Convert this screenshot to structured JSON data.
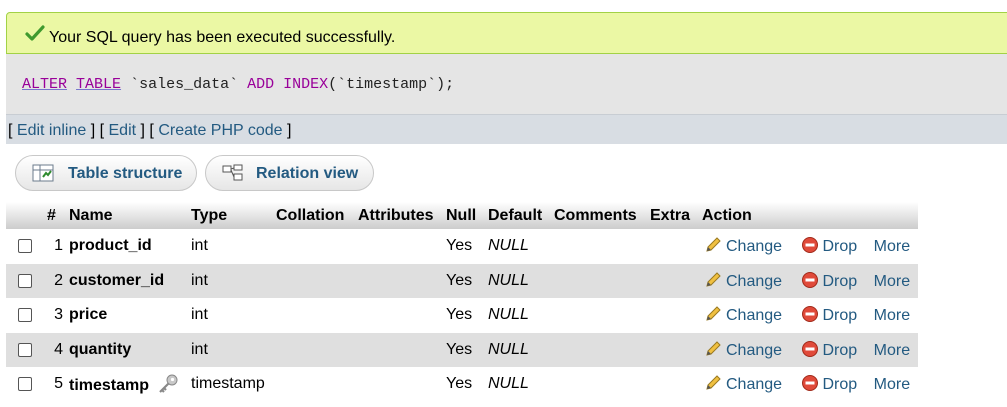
{
  "message": {
    "text": "Your SQL query has been executed successfully."
  },
  "sql": {
    "kw_alter": "ALTER",
    "kw_table": "TABLE",
    "table_name": "`sales_data`",
    "kw_add": "ADD",
    "kw_index": "INDEX",
    "arg": "(`timestamp`);"
  },
  "links": {
    "edit_inline": "Edit inline",
    "edit": "Edit",
    "create_php": "Create PHP code"
  },
  "tabs": {
    "structure": "Table structure",
    "relation": "Relation view"
  },
  "table": {
    "headers": {
      "num": "#",
      "name": "Name",
      "type": "Type",
      "collation": "Collation",
      "attributes": "Attributes",
      "null": "Null",
      "default": "Default",
      "comments": "Comments",
      "extra": "Extra",
      "action": "Action"
    },
    "rows": [
      {
        "num": "1",
        "name": "product_id",
        "type": "int",
        "null": "Yes",
        "default": "NULL"
      },
      {
        "num": "2",
        "name": "customer_id",
        "type": "int",
        "null": "Yes",
        "default": "NULL"
      },
      {
        "num": "3",
        "name": "price",
        "type": "int",
        "null": "Yes",
        "default": "NULL"
      },
      {
        "num": "4",
        "name": "quantity",
        "type": "int",
        "null": "Yes",
        "default": "NULL"
      },
      {
        "num": "5",
        "name": "timestamp",
        "type": "timestamp",
        "null": "Yes",
        "default": "NULL"
      }
    ],
    "actions": {
      "change": "Change",
      "drop": "Drop",
      "more": "More"
    }
  }
}
